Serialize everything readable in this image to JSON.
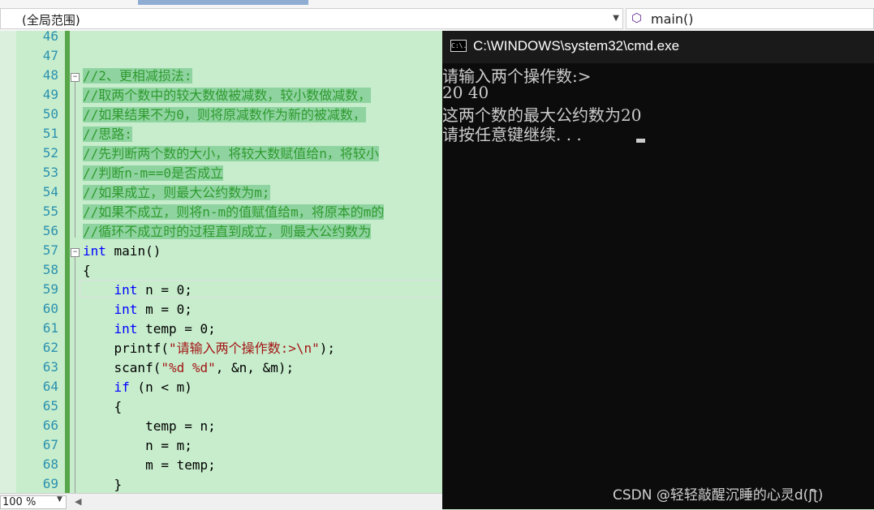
{
  "toolbar": {
    "scope_label": "(全局范围)",
    "function_label": "main()",
    "function_icon": "cube-icon"
  },
  "editor": {
    "lines": [
      {
        "num": "46",
        "text": ""
      },
      {
        "num": "47",
        "text": ""
      },
      {
        "num": "48",
        "text": "//2、更相减损法:"
      },
      {
        "num": "49",
        "text": "//取两个数中的较大数做被减数，较小数做减数，"
      },
      {
        "num": "50",
        "text": "//如果结果不为0，则将原减数作为新的被减数，"
      },
      {
        "num": "51",
        "text": "//思路:"
      },
      {
        "num": "52",
        "text": "//先判断两个数的大小，将较大数赋值给n，将较小"
      },
      {
        "num": "53",
        "text": "//判断n-m==0是否成立"
      },
      {
        "num": "54",
        "text": "//如果成立，则最大公约数为m;"
      },
      {
        "num": "55",
        "text": "//如果不成立，则将n-m的值赋值给m，将原本的m的"
      },
      {
        "num": "56",
        "text": "//循环不成立时的过程直到成立，则最大公约数为"
      },
      {
        "num": "57",
        "text": "int main()"
      },
      {
        "num": "58",
        "text": "{"
      },
      {
        "num": "59",
        "text": "    int n = 0;"
      },
      {
        "num": "60",
        "text": "    int m = 0;"
      },
      {
        "num": "61",
        "text": "    int temp = 0;"
      },
      {
        "num": "62",
        "text": "    printf(\"请输入两个操作数:>\\n\");"
      },
      {
        "num": "63",
        "text": "    scanf(\"%d %d\", &n, &m);"
      },
      {
        "num": "64",
        "text": "    if (n < m)"
      },
      {
        "num": "65",
        "text": "    {"
      },
      {
        "num": "66",
        "text": "        temp = n;"
      },
      {
        "num": "67",
        "text": "        n = m;"
      },
      {
        "num": "68",
        "text": "        m = temp;"
      },
      {
        "num": "69",
        "text": "    }"
      }
    ]
  },
  "statusbar": {
    "zoom": "100 %"
  },
  "console": {
    "title": "C:\\WINDOWS\\system32\\cmd.exe",
    "icon_text": "C:\\.",
    "lines": [
      "请输入两个操作数:>",
      "20 40",
      "这两个数的最大公约数为20",
      "请按任意键继续. . ."
    ],
    "watermark": "CSDN @轻轻敲醒沉睡的心灵d(ʃƪ)"
  },
  "colors": {
    "editor_bg": "#c7edcc",
    "comment": "#2e9a2e",
    "keyword": "#0000ff",
    "string": "#a31515",
    "line_number": "#2b91af",
    "console_bg": "#0c0c0c"
  }
}
